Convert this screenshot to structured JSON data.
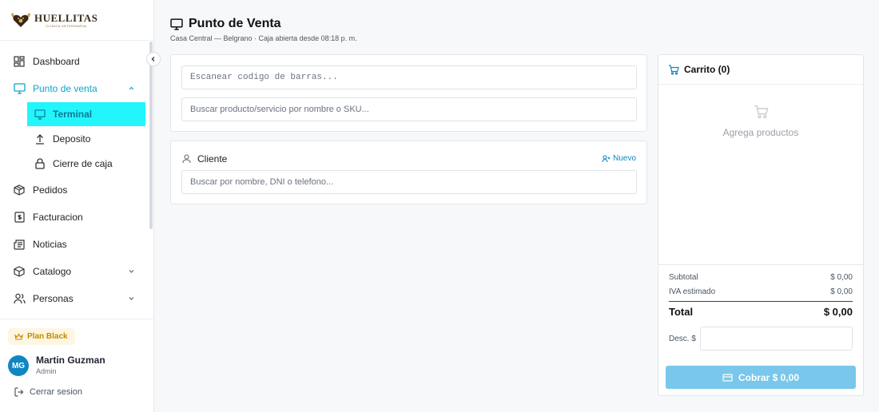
{
  "brand": {
    "name": "HUELLITAS",
    "tagline": "CLINICA VETERINARIA"
  },
  "sidebar": {
    "items": [
      {
        "label": "Dashboard",
        "icon": "dashboard-icon"
      },
      {
        "label": "Punto de venta",
        "icon": "monitor-icon",
        "expanded": true
      },
      {
        "label": "Pedidos",
        "icon": "package-icon"
      },
      {
        "label": "Facturacion",
        "icon": "invoice-icon"
      },
      {
        "label": "Noticias",
        "icon": "newspaper-icon"
      },
      {
        "label": "Catalogo",
        "icon": "box-icon"
      },
      {
        "label": "Personas",
        "icon": "users-icon"
      }
    ],
    "subitems": [
      {
        "label": "Terminal",
        "icon": "monitor-icon",
        "active": true
      },
      {
        "label": "Deposito",
        "icon": "upload-icon"
      },
      {
        "label": "Cierre de caja",
        "icon": "lock-icon"
      }
    ],
    "plan": "Plan Black",
    "user": {
      "initials": "MG",
      "name": "Martin Guzman",
      "role": "Admin"
    },
    "logout": "Cerrar sesion"
  },
  "header": {
    "title": "Punto de Venta",
    "subtitle": "Casa Central — Belgrano · Caja abierta desde 08:18 p. m."
  },
  "search": {
    "barcode_placeholder": "Escanear codigo de barras...",
    "product_placeholder": "Buscar producto/servicio por nombre o SKU..."
  },
  "client": {
    "title": "Cliente",
    "new_label": "Nuevo",
    "placeholder": "Buscar por nombre, DNI o telefono..."
  },
  "cart": {
    "title": "Carrito (0)",
    "empty_text": "Agrega productos",
    "subtotal_label": "Subtotal",
    "subtotal_value": "$ 0,00",
    "iva_label": "IVA estimado",
    "iva_value": "$ 0,00",
    "total_label": "Total",
    "total_value": "$ 0,00",
    "discount_label": "Desc. $",
    "pay_label": "Cobrar $ 0,00"
  },
  "colors": {
    "accent": "#0ea5c6",
    "active_bg": "#22f5fb",
    "pay_button": "#79c7ea",
    "plan_badge": "#c48a00",
    "avatar": "#0f86c2"
  }
}
